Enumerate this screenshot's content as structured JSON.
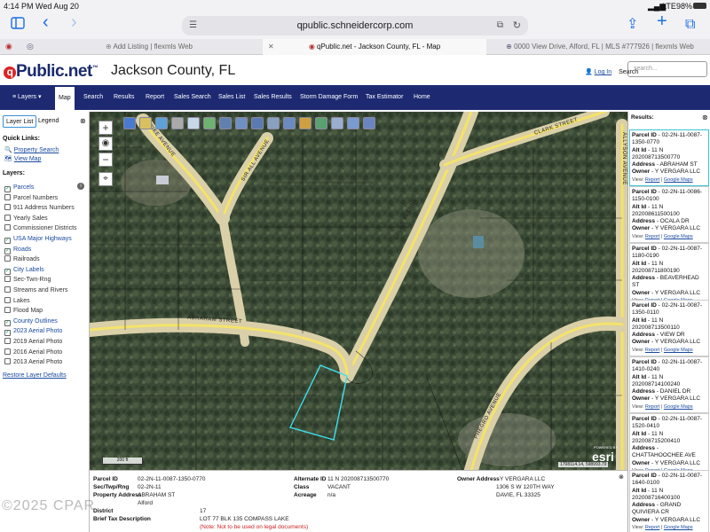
{
  "status_bar": {
    "time": "4:14 PM",
    "date": "Wed Aug 20",
    "network": "LTE",
    "battery": "98%"
  },
  "browser": {
    "url": "qpublic.schneidercorp.com"
  },
  "tabs": [
    {
      "label": "Add Listing | flexmls Web"
    },
    {
      "label": "qPublic.net - Jackson County, FL - Map"
    },
    {
      "label": "0000 View Drive, Alford, FL | MLS #777926 | flexmls Web"
    }
  ],
  "header": {
    "logo_q": "q",
    "logo_rest": "Public.net",
    "logo_tm": "™",
    "county": "Jackson County, FL",
    "login": "Log In",
    "search_label": "Search",
    "search_placeholder": "search..."
  },
  "nav": [
    {
      "label": "Layers ▾"
    },
    {
      "label": "Map"
    },
    {
      "label": "Search"
    },
    {
      "label": "Results"
    },
    {
      "label": "Report"
    },
    {
      "label": "Sales Search"
    },
    {
      "label": "Sales List"
    },
    {
      "label": "Sales Results"
    },
    {
      "label": "Storm Damage Form"
    },
    {
      "label": "Tax Estimator"
    },
    {
      "label": "Home"
    }
  ],
  "layer_panel": {
    "tab_layer_list": "Layer List",
    "tab_legend": "Legend",
    "quick_links_title": "Quick Links:",
    "quick_links": [
      "Property Search",
      "View Map"
    ],
    "layers_title": "Layers:",
    "layers": [
      {
        "label": "Parcels",
        "checked": true
      },
      {
        "label": "Parcel Numbers",
        "checked": false
      },
      {
        "label": "911 Address Numbers",
        "checked": false
      },
      {
        "label": "Yearly Sales",
        "checked": false
      },
      {
        "label": "Commissioner Districts",
        "checked": false
      },
      {
        "label": "USA Major Highways",
        "checked": true
      },
      {
        "label": "Roads",
        "checked": true
      },
      {
        "label": "Railroads",
        "checked": false
      },
      {
        "label": "City Labels",
        "checked": true
      },
      {
        "label": "Sec-Twn-Rng",
        "checked": false
      },
      {
        "label": "Streams and Rivers",
        "checked": false
      },
      {
        "label": "Lakes",
        "checked": false
      },
      {
        "label": "Flood Map",
        "checked": false
      },
      {
        "label": "County Outlines",
        "checked": true
      },
      {
        "label": "2023 Aerial Photo",
        "checked": true
      },
      {
        "label": "2019 Aerial Photo",
        "checked": false
      },
      {
        "label": "2016 Aerial Photo",
        "checked": false
      },
      {
        "label": "2013 Aerial Photo",
        "checked": false
      }
    ],
    "restore": "Restore Layer Defaults"
  },
  "map": {
    "streets": [
      "SPIKE AVENUE",
      "SIR ALL AVENUE",
      "CALOS AVENUE",
      "CLARK STREET",
      "ABRAHAM STREET",
      "ALLYSON AVENUE",
      "PHEGRO AVENUE"
    ],
    "scale": "200 ft",
    "coords": "1708114.14, 598993.79",
    "esri_powered": "POWERED BY",
    "esri": "esri"
  },
  "results": {
    "title": "Results:",
    "view_prefix": "View:",
    "report_link": "Report",
    "maps_link": "Google Maps",
    "items": [
      {
        "parcel": "02-2N-11-0087-1350-0770",
        "alt": "11 N 202008713500770",
        "address": "ABRAHAM ST",
        "owner": "Y VERGARA LLC"
      },
      {
        "parcel": "02-2N-11-0086-1150-0100",
        "alt": "11 N 202008611500100",
        "address": "OCALA DR",
        "owner": "Y VERGARA LLC"
      },
      {
        "parcel": "02-2N-11-0087-1180-0190",
        "alt": "11 N 202008711800190",
        "address": "BEAVERHEAD ST",
        "owner": "Y VERGARA LLC"
      },
      {
        "parcel": "02-2N-11-0087-1350-0110",
        "alt": "11 N 202008713500110",
        "address": "VIEW DR",
        "owner": "Y VERGARA LLC"
      },
      {
        "parcel": "02-2N-11-0087-1410-0240",
        "alt": "11 N 202008714100240",
        "address": "DANIEL DR",
        "owner": "Y VERGARA LLC"
      },
      {
        "parcel": "02-2N-11-0087-1520-0410",
        "alt": "11 N 202008715200410",
        "address": "CHATTAHOOCHEE AVE",
        "owner": "Y VERGARA LLC"
      },
      {
        "parcel": "02-2N-11-0087-1640-0100",
        "alt": "11 N 202008716400100",
        "address": "GRAND QUIVIERA CR",
        "owner": "Y VERGARA LLC"
      }
    ],
    "labels": {
      "parcel": "Parcel ID",
      "alt": "Alt Id",
      "address": "Address",
      "owner": "Owner"
    }
  },
  "info": {
    "parcel_id_k": "Parcel ID",
    "parcel_id": "02-2N-11-0087-1350-0770",
    "sec_k": "Sec/Twp/Rng",
    "sec": "02-2N-11",
    "addr_k": "Property Address",
    "addr": "ABRAHAM ST",
    "addr2": "Alford",
    "district_k": "District",
    "district": "17",
    "brief_k": "Brief Tax Description",
    "brief": "LOT 77 BLK 135 COMPASS LAKE",
    "brief_note": "(Note: Not to be used on legal documents)",
    "alt_k": "Alternate ID",
    "alt": "11 N 202008713500770",
    "class_k": "Class",
    "class": "VACANT",
    "acreage_k": "Acreage",
    "acreage": "n/a",
    "owner_k": "Owner Address",
    "owner": "Y VERGARA LLC",
    "owner2": "1306 S W 120TH WAY",
    "owner3": "DAVIE, FL 33325"
  },
  "watermark": "©2025 CPAR"
}
